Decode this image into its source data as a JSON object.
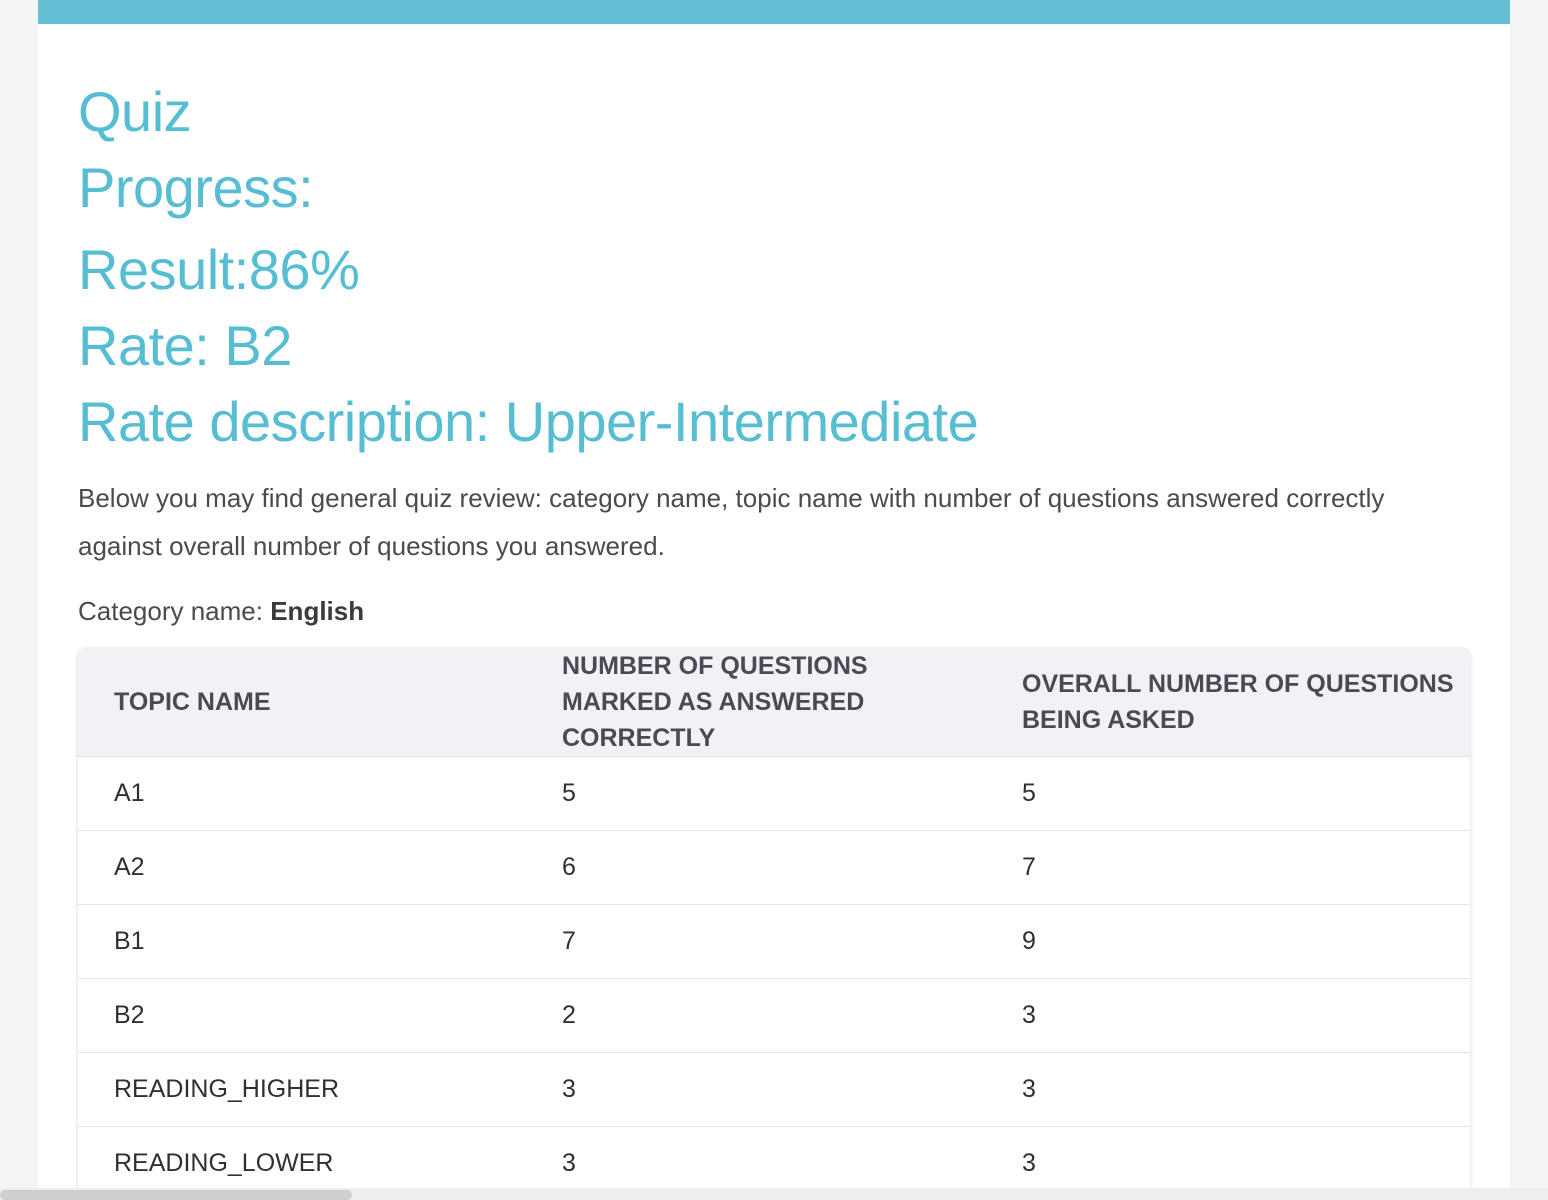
{
  "headings": {
    "quiz": "Quiz",
    "progress": "Progress:",
    "result": "Result:86%",
    "rate": "Rate: B2",
    "rate_description": "Rate description: Upper-Intermediate"
  },
  "intro": "Below you may find general quiz review: category name, topic name with number of questions answered correctly against overall number of questions you answered.",
  "category": {
    "label": "Category name:",
    "value": "English"
  },
  "table": {
    "headers": [
      "TOPIC NAME",
      "NUMBER OF QUESTIONS MARKED AS ANSWERED CORRECTLY",
      "OVERALL NUMBER OF QUESTIONS BEING ASKED"
    ],
    "rows": [
      [
        "A1",
        "5",
        "5"
      ],
      [
        "A2",
        "6",
        "7"
      ],
      [
        "B1",
        "7",
        "9"
      ],
      [
        "B2",
        "2",
        "3"
      ],
      [
        "READING_HIGHER",
        "3",
        "3"
      ],
      [
        "READING_LOWER",
        "3",
        "3"
      ]
    ]
  },
  "colors": {
    "accent": "#63bfd3",
    "heading": "#56bdd3",
    "header_row_bg": "#f1f2f6"
  }
}
